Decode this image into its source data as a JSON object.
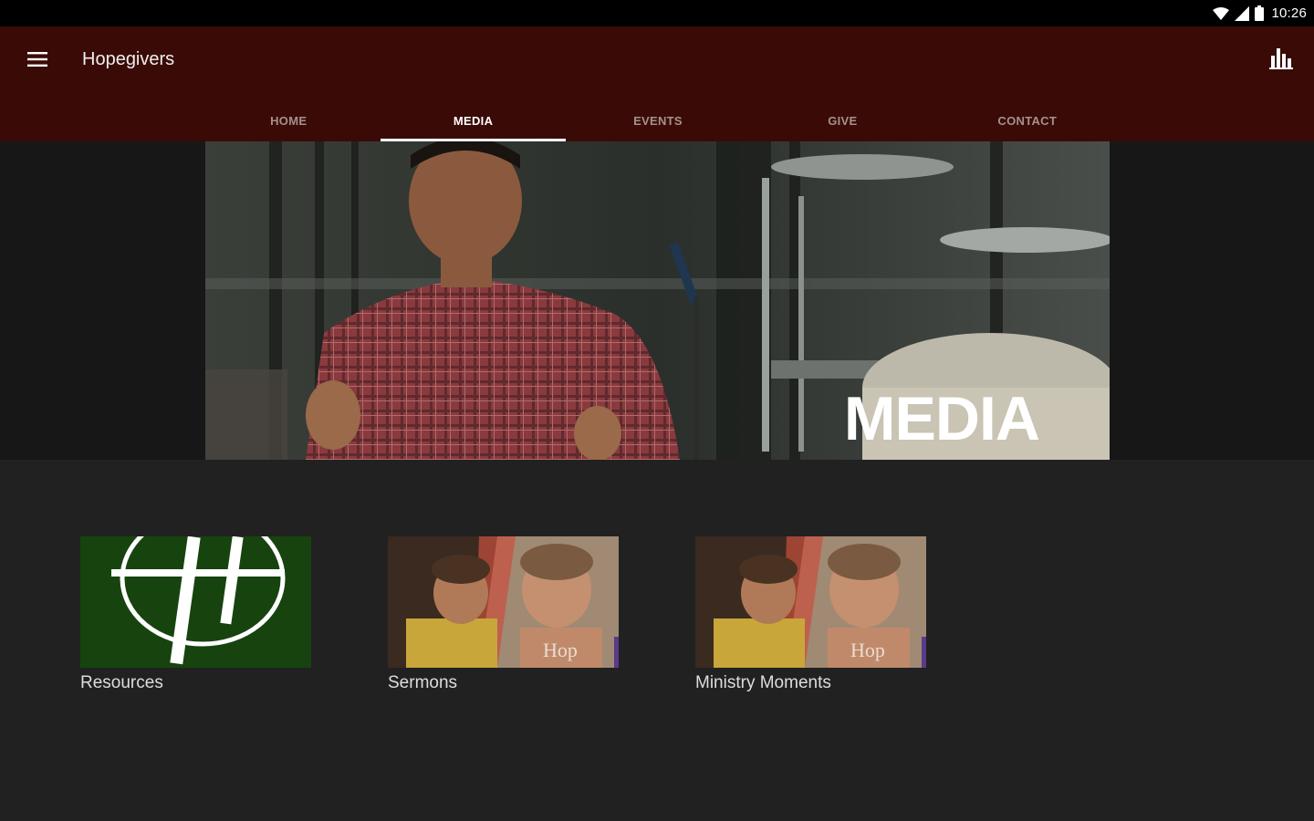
{
  "status_bar": {
    "time": "10:26"
  },
  "app_bar": {
    "title": "Hopegivers"
  },
  "tabs": [
    {
      "label": "HOME",
      "active": false
    },
    {
      "label": "MEDIA",
      "active": true
    },
    {
      "label": "EVENTS",
      "active": false
    },
    {
      "label": "GIVE",
      "active": false
    },
    {
      "label": "CONTACT",
      "active": false
    }
  ],
  "hero": {
    "text": "MEDIA"
  },
  "items": [
    {
      "label": "Resources",
      "thumb": "hopegivers-logo"
    },
    {
      "label": "Sermons",
      "thumb": "children-photo"
    },
    {
      "label": "Ministry Moments",
      "thumb": "children-photo"
    }
  ],
  "colors": {
    "app_bar": "#3a0b06",
    "background": "#212121",
    "logo_green": "#17430f"
  }
}
